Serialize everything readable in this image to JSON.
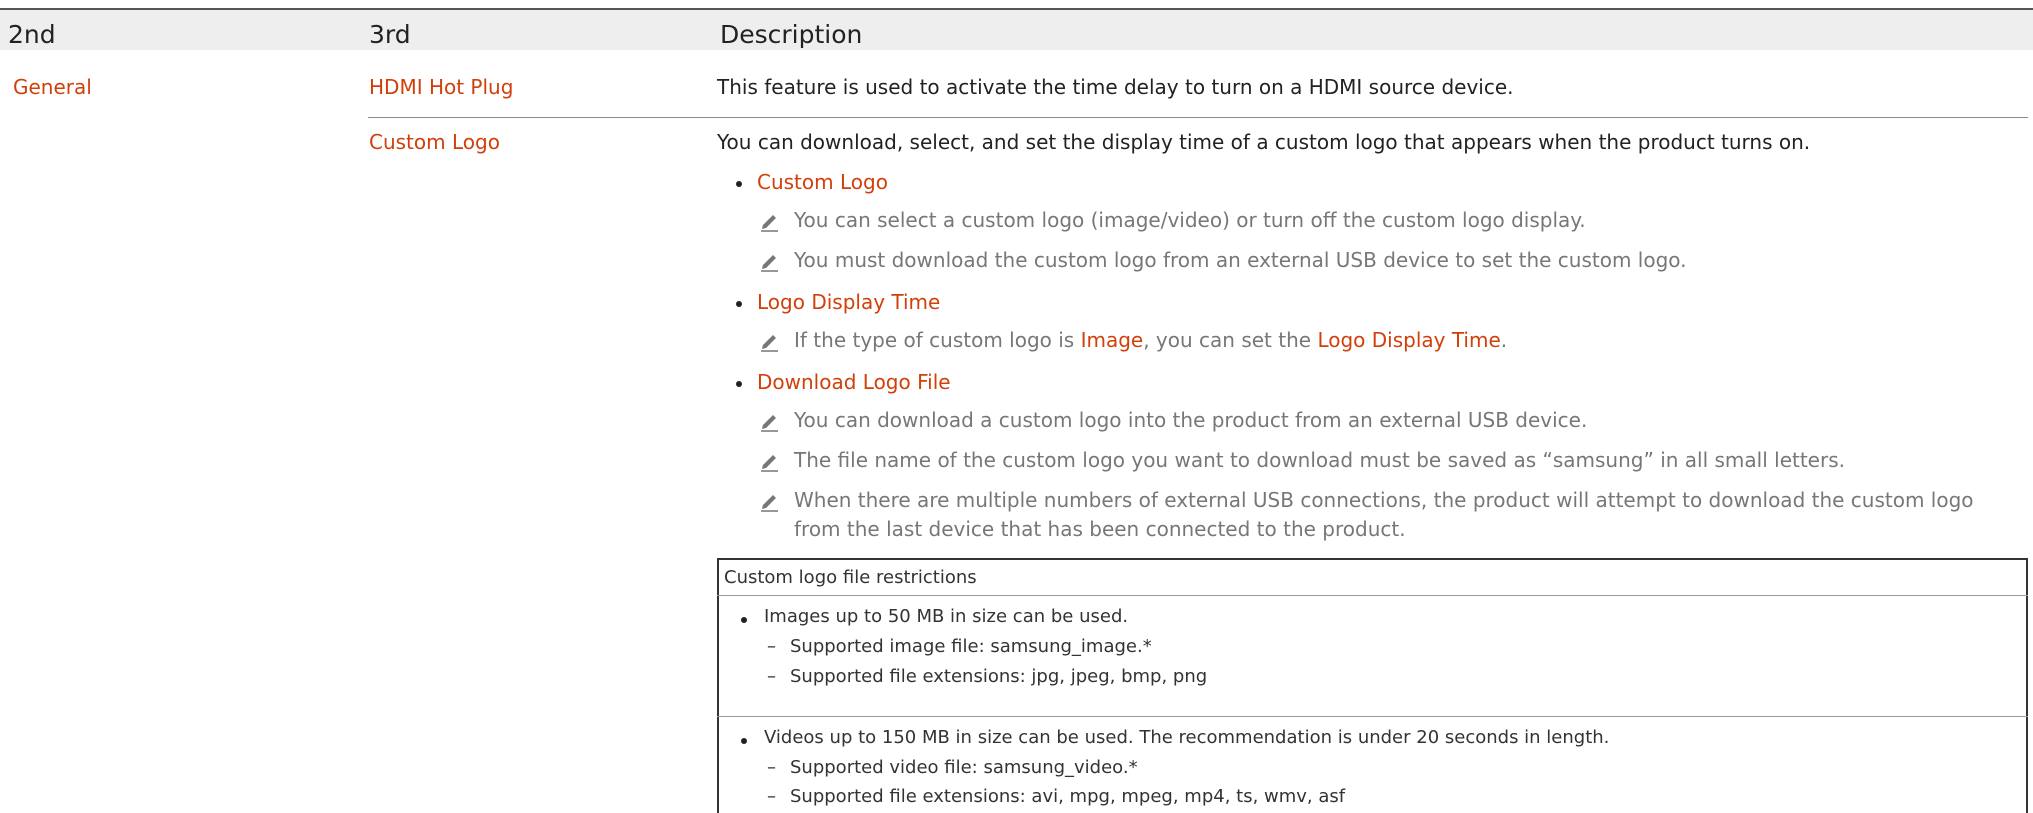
{
  "headers": {
    "col1": "2nd",
    "col2": "3rd",
    "col3": "Description"
  },
  "row1": {
    "category": "General",
    "item": "HDMI Hot Plug",
    "description": "This feature is used to activate the time delay to turn on a HDMI source device."
  },
  "row2": {
    "item": "Custom Logo",
    "intro": "You can download, select, and set the display time of a custom logo that appears when the product turns on.",
    "bullets": [
      {
        "title": "Custom Logo",
        "notes": [
          "You can select a custom logo (image/video) or turn off the custom logo display.",
          "You must download the custom logo from an external USB device to set the custom logo."
        ]
      },
      {
        "title": "Logo Display Time",
        "note": {
          "pre": "If the type of custom logo is ",
          "term1": "Image",
          "mid": ", you can set the ",
          "term2": "Logo Display Time",
          "post": "."
        }
      },
      {
        "title": "Download Logo File",
        "notes": [
          "You can download a custom logo into the product from an external USB device.",
          "The file name of the custom logo you want to download must be saved as “samsung” in all small letters.",
          "When there are multiple numbers of external USB connections, the product will attempt to download the custom logo",
          "from the last device that has been connected to the product."
        ]
      }
    ]
  },
  "restrictions": {
    "title": "Custom logo file restrictions",
    "images": {
      "line": "Images up to 50 MB in size can be used.",
      "subs": [
        "Supported image file: samsung_image.*",
        "Supported file extensions: jpg, jpeg, bmp, png"
      ]
    },
    "videos": {
      "line": "Videos up to 150 MB in size can be used. The recommendation is under 20 seconds in length.",
      "subs": [
        "Supported video file: samsung_video.*",
        "Supported file extensions: avi, mpg, mpeg, mp4, ts, wmv, asf"
      ]
    },
    "dash": "–"
  },
  "colors": {
    "accent": "#d2400a",
    "note_text": "#777777",
    "header_bg": "#eeeeee"
  },
  "icons": {
    "note": "pencil-icon",
    "bullet": "bullet-dot"
  }
}
